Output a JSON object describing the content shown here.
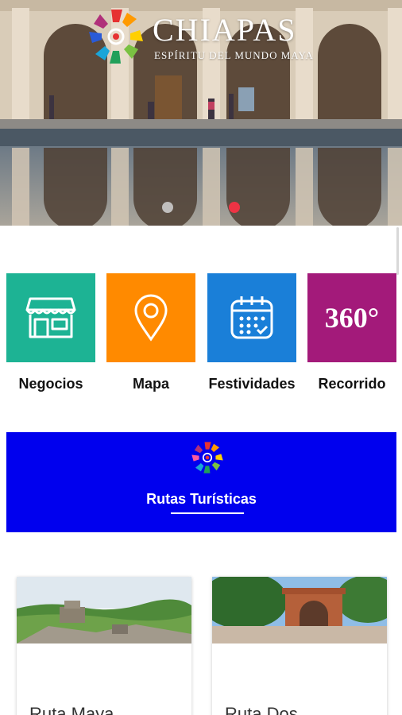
{
  "hero": {
    "brand_name": "CHIAPAS",
    "brand_tagline": "ESPÍRITU DEL MUNDO MAYA",
    "slides": 2,
    "active_slide": 2,
    "dot_active_color": "#ee3344"
  },
  "menu": [
    {
      "label": "Negocios",
      "icon": "storefront-icon",
      "color": "#1db394"
    },
    {
      "label": "Mapa",
      "icon": "map-pin-icon",
      "color": "#ff8a00"
    },
    {
      "label": "Festividades",
      "icon": "calendar-icon",
      "color": "#1a7fd8"
    },
    {
      "label": "Recorrido",
      "icon": "360",
      "color": "#a31a7a"
    }
  ],
  "banner": {
    "title": "Rutas Turísticas",
    "color": "#0000ee",
    "icon": "chiapas-logo-icon"
  },
  "routes": [
    {
      "title": "Ruta Maya"
    },
    {
      "title": "Ruta Dos"
    }
  ]
}
